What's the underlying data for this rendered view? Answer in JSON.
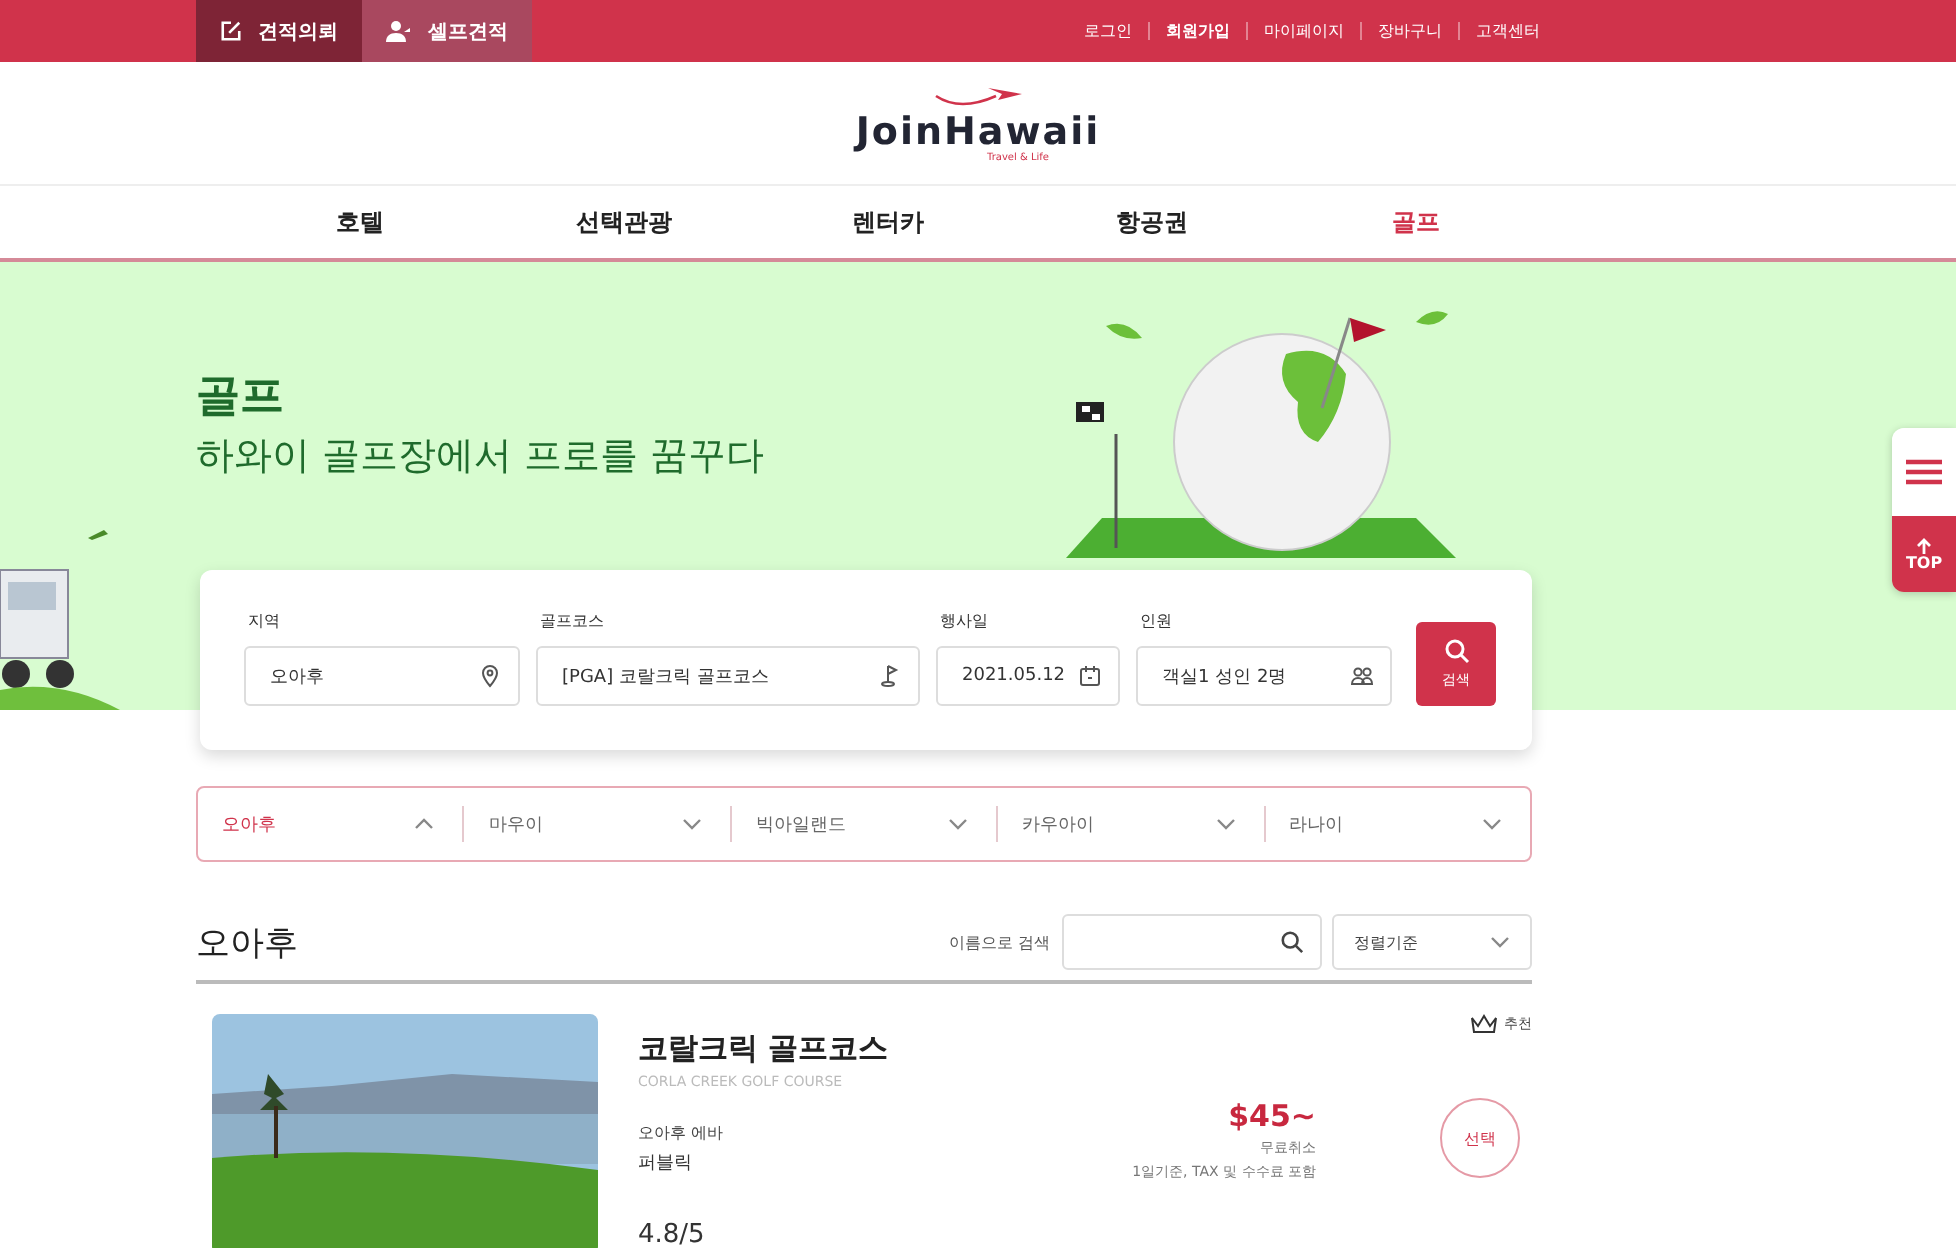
{
  "top_bar": {
    "quick_tabs": [
      {
        "label": "견적의뢰",
        "selected": true,
        "kind": "edit"
      },
      {
        "label": "셀프견적",
        "selected": false,
        "kind": "user"
      }
    ],
    "user_links": [
      {
        "label": "로그인",
        "bold": false
      },
      {
        "label": "회원가입",
        "bold": true
      },
      {
        "label": "마이페이지",
        "bold": false
      },
      {
        "label": "장바구니",
        "bold": false
      },
      {
        "label": "고객센터",
        "bold": false
      }
    ]
  },
  "logo": {
    "name": "JoinHawaii",
    "tagline": "Travel & Life"
  },
  "nav": [
    {
      "label": "호텔",
      "selected": false
    },
    {
      "label": "선택관광",
      "selected": false
    },
    {
      "label": "렌터카",
      "selected": false
    },
    {
      "label": "항공권",
      "selected": false
    },
    {
      "label": "골프",
      "selected": true
    }
  ],
  "hero": {
    "title": "골프",
    "subtitle": "하와이 골프장에서 프로를 꿈꾸다"
  },
  "search": {
    "fields": [
      {
        "label": "지역",
        "value": "오아후",
        "kind": "location"
      },
      {
        "label": "골프코스",
        "value": "[PGA] 코랄크릭 골프코스",
        "kind": "course"
      },
      {
        "label": "행사일",
        "value": "2021.05.12",
        "kind": "date"
      },
      {
        "label": "인원",
        "value": "객실1  성인 2명",
        "kind": "people"
      }
    ],
    "button": "검색"
  },
  "regions": [
    {
      "label": "오아후",
      "expanded": true
    },
    {
      "label": "마우이",
      "expanded": false
    },
    {
      "label": "빅아일랜드",
      "expanded": false
    },
    {
      "label": "카우아이",
      "expanded": false
    },
    {
      "label": "라나이",
      "expanded": false
    }
  ],
  "results": {
    "heading": "오아후",
    "search_label": "이름으로 검색",
    "sort": "정렬기준"
  },
  "courses": [
    {
      "name": "코랄크릭 골프코스",
      "name_en": "CORLA CREEK GOLF COURSE",
      "area": "오아후 에바",
      "type": "퍼블릭",
      "badge": "추천",
      "price": "$45~",
      "price_note": "무료취소",
      "price_detail": "1일기준, TAX 및 수수료 포함",
      "button": "선택",
      "rating": "4.8/5"
    }
  ],
  "side_widget": {
    "top_label": "TOP"
  }
}
